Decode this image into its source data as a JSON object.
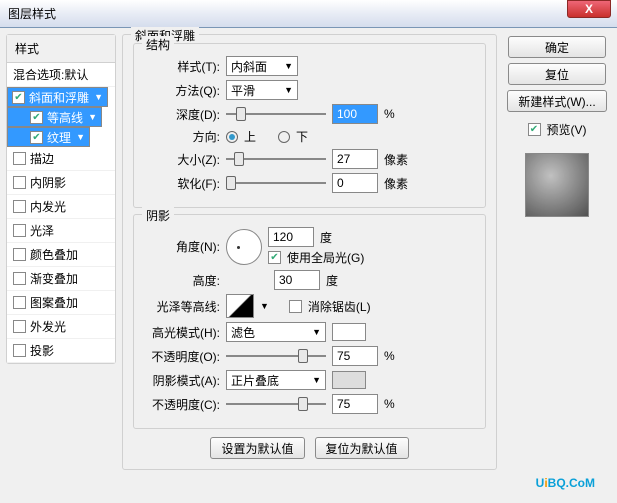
{
  "title": "图层样式",
  "close": "X",
  "sidebar": {
    "header": "样式",
    "blend": "混合选项:默认",
    "items": [
      {
        "label": "斜面和浮雕",
        "checked": true,
        "sel": true,
        "indent": false
      },
      {
        "label": "等高线",
        "checked": true,
        "sel": true,
        "indent": true
      },
      {
        "label": "纹理",
        "checked": true,
        "sel": true,
        "indent": true
      },
      {
        "label": "描边",
        "checked": false,
        "sel": false,
        "indent": false
      },
      {
        "label": "内阴影",
        "checked": false,
        "sel": false,
        "indent": false
      },
      {
        "label": "内发光",
        "checked": false,
        "sel": false,
        "indent": false
      },
      {
        "label": "光泽",
        "checked": false,
        "sel": false,
        "indent": false
      },
      {
        "label": "颜色叠加",
        "checked": false,
        "sel": false,
        "indent": false
      },
      {
        "label": "渐变叠加",
        "checked": false,
        "sel": false,
        "indent": false
      },
      {
        "label": "图案叠加",
        "checked": false,
        "sel": false,
        "indent": false
      },
      {
        "label": "外发光",
        "checked": false,
        "sel": false,
        "indent": false
      },
      {
        "label": "投影",
        "checked": false,
        "sel": false,
        "indent": false
      }
    ]
  },
  "bevel": {
    "group": "斜面和浮雕",
    "struct": "结构",
    "styleLbl": "样式(T):",
    "styleVal": "内斜面",
    "techLbl": "方法(Q):",
    "techVal": "平滑",
    "depthLbl": "深度(D):",
    "depthVal": "100",
    "pct": "%",
    "dirLbl": "方向:",
    "up": "上",
    "down": "下",
    "sizeLbl": "大小(Z):",
    "sizeVal": "27",
    "px": "像素",
    "softLbl": "软化(F):",
    "softVal": "0",
    "shade": "阴影",
    "angleLbl": "角度(N):",
    "angleVal": "120",
    "deg": "度",
    "globalLbl": "使用全局光(G)",
    "altLbl": "高度:",
    "altVal": "30",
    "glossLbl": "光泽等高线:",
    "aaLbl": "消除锯齿(L)",
    "hiLbl": "高光模式(H):",
    "hiVal": "滤色",
    "hiOpLbl": "不透明度(O):",
    "hiOpVal": "75",
    "shLbl": "阴影模式(A):",
    "shVal": "正片叠底",
    "shOpLbl": "不透明度(C):",
    "shOpVal": "75",
    "defBtn": "设置为默认值",
    "resetBtn": "复位为默认值"
  },
  "right": {
    "ok": "确定",
    "reset": "复位",
    "newStyle": "新建样式(W)...",
    "previewLbl": "预览(V)"
  },
  "watermark": {
    "a": "U",
    "b": "i",
    "c": "BQ.CoM"
  }
}
